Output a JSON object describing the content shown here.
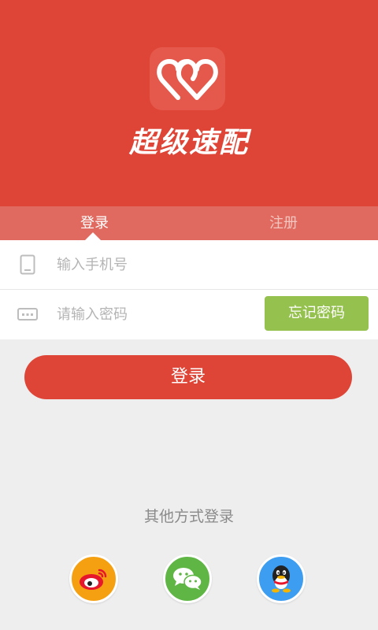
{
  "app": {
    "name": "超级速配",
    "logo_icon": "double-heart-logo-icon"
  },
  "colors": {
    "brand_red": "#de4537",
    "tab_bar": "#e06a5f",
    "forgot_green": "#95c14e",
    "background": "#eeeeee",
    "weibo": "#f5a011",
    "wechat": "#5fb645",
    "qq": "#3d9df0"
  },
  "tabs": [
    {
      "label": "登录",
      "active": true
    },
    {
      "label": "注册",
      "active": false
    }
  ],
  "form": {
    "phone": {
      "icon": "phone-icon",
      "placeholder": "输入手机号",
      "value": ""
    },
    "password": {
      "icon": "keyboard-icon",
      "placeholder": "请输入密码",
      "value": ""
    },
    "forgot_label": "忘记密码"
  },
  "login_button": {
    "label": "登录"
  },
  "other_login": {
    "label": "其他方式登录",
    "providers": [
      {
        "icon": "weibo-icon"
      },
      {
        "icon": "wechat-icon"
      },
      {
        "icon": "qq-icon"
      }
    ]
  }
}
